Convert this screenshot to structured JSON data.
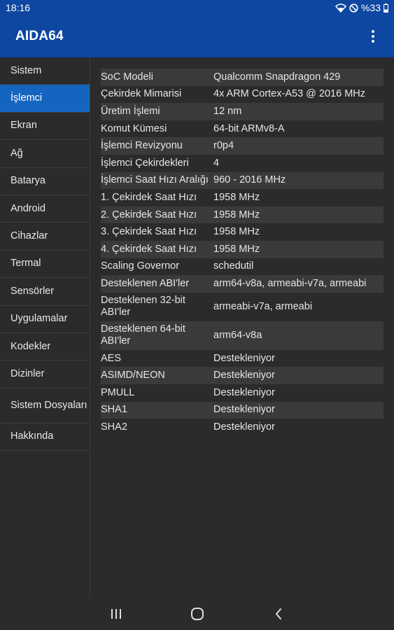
{
  "status": {
    "time": "18:16",
    "battery": "%33"
  },
  "app": {
    "title": "AIDA64"
  },
  "sidebar": {
    "items": [
      {
        "label": "Sistem"
      },
      {
        "label": "İşlemci"
      },
      {
        "label": "Ekran"
      },
      {
        "label": "Ağ"
      },
      {
        "label": "Batarya"
      },
      {
        "label": "Android"
      },
      {
        "label": "Cihazlar"
      },
      {
        "label": "Termal"
      },
      {
        "label": "Sensörler"
      },
      {
        "label": "Uygulamalar"
      },
      {
        "label": "Kodekler"
      },
      {
        "label": "Dizinler"
      },
      {
        "label": "Sistem Dosyaları"
      },
      {
        "label": "Hakkında"
      }
    ],
    "active": "İşlemci"
  },
  "properties": [
    {
      "key": "SoC Modeli",
      "value": "Qualcomm Snapdragon 429"
    },
    {
      "key": "Çekirdek Mimarisi",
      "value": "4x ARM Cortex-A53 @ 2016 MHz"
    },
    {
      "key": "Üretim İşlemi",
      "value": "12 nm"
    },
    {
      "key": "Komut Kümesi",
      "value": "64-bit ARMv8-A"
    },
    {
      "key": "İşlemci Revizyonu",
      "value": "r0p4"
    },
    {
      "key": "İşlemci Çekirdekleri",
      "value": "4"
    },
    {
      "key": "İşlemci Saat Hızı Aralığı",
      "value": "960 - 2016 MHz"
    },
    {
      "key": "1. Çekirdek Saat Hızı",
      "value": "1958 MHz"
    },
    {
      "key": "2. Çekirdek Saat Hızı",
      "value": "1958 MHz"
    },
    {
      "key": "3. Çekirdek Saat Hızı",
      "value": "1958 MHz"
    },
    {
      "key": "4. Çekirdek Saat Hızı",
      "value": "1958 MHz"
    },
    {
      "key": "Scaling Governor",
      "value": "schedutil"
    },
    {
      "key": "Desteklenen ABI'ler",
      "value": "arm64-v8a, armeabi-v7a, armeabi"
    },
    {
      "key": "Desteklenen 32-bit ABI'ler",
      "value": "armeabi-v7a, armeabi"
    },
    {
      "key": "Desteklenen 64-bit ABI'ler",
      "value": "arm64-v8a"
    },
    {
      "key": "AES",
      "value": "Destekleniyor"
    },
    {
      "key": "ASIMD/NEON",
      "value": "Destekleniyor"
    },
    {
      "key": "PMULL",
      "value": "Destekleniyor"
    },
    {
      "key": "SHA1",
      "value": "Destekleniyor"
    },
    {
      "key": "SHA2",
      "value": "Destekleniyor"
    }
  ],
  "colors": {
    "accent": "#0d47a1",
    "active_item": "#1565c0",
    "background": "#2b2b2b",
    "row_stripe": "#3a3a3a"
  },
  "icons": {
    "status": [
      "wifi-icon",
      "do-not-disturb-icon",
      "battery-icon"
    ],
    "appbar": [
      "more-vert-icon"
    ],
    "navbar": [
      "recents-icon",
      "home-icon",
      "back-icon"
    ]
  }
}
